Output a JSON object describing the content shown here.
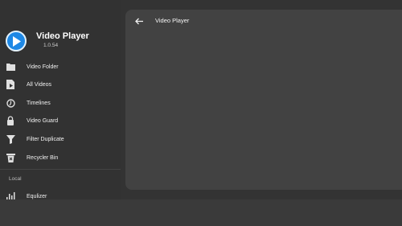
{
  "app": {
    "title": "Video Player",
    "version": "1.0.54",
    "accent": "#1e88e5"
  },
  "drawer": {
    "items": [
      {
        "label": "Video Folder",
        "icon": "folder-icon"
      },
      {
        "label": "All Videos",
        "icon": "video-file-icon"
      },
      {
        "label": "Timelines",
        "icon": "timeline-icon"
      },
      {
        "label": "Video Guard",
        "icon": "lock-icon"
      },
      {
        "label": "Filter Duplicate",
        "icon": "filter-icon"
      },
      {
        "label": "Recycler Bin",
        "icon": "trash-icon"
      }
    ],
    "section_label": "Local",
    "local_items": [
      {
        "label": "Equlizer",
        "icon": "equalizer-icon"
      }
    ]
  },
  "panel": {
    "title": "Video Player",
    "back_icon": "arrow-back-icon"
  }
}
